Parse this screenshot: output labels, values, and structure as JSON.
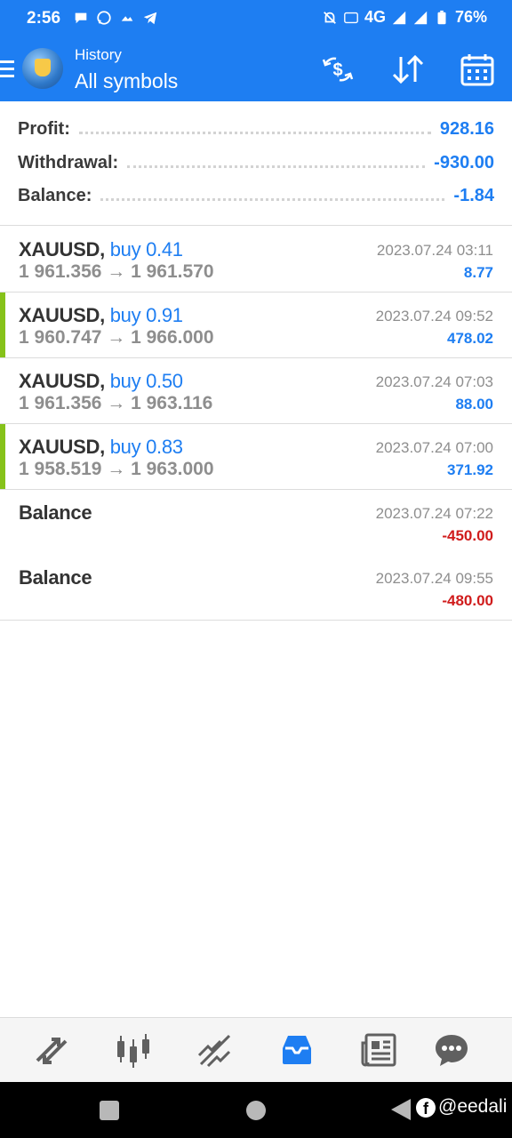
{
  "status": {
    "time": "2:56",
    "network": "4G",
    "battery": "76%"
  },
  "appbar": {
    "subtitle": "History",
    "title": "All symbols",
    "actions": [
      "currency-exchange-icon",
      "sort-icon",
      "calendar-icon"
    ]
  },
  "summary": {
    "profit_label": "Profit:",
    "profit_value": "928.16",
    "withdrawal_label": "Withdrawal:",
    "withdrawal_value": "-930.00",
    "balance_label": "Balance:",
    "balance_value": "-1.84"
  },
  "deals": [
    {
      "symbol": "XAUUSD,",
      "type": "buy 0.41",
      "prices": "1 961.356 → 1 961.570",
      "time": "2023.07.24 03:11",
      "pl": "8.77",
      "highlight": false
    },
    {
      "symbol": "XAUUSD,",
      "type": "buy 0.91",
      "prices": "1 960.747 → 1 966.000",
      "time": "2023.07.24 09:52",
      "pl": "478.02",
      "highlight": true
    },
    {
      "symbol": "XAUUSD,",
      "type": "buy 0.50",
      "prices": "1 961.356 → 1 963.116",
      "time": "2023.07.24 07:03",
      "pl": "88.00",
      "highlight": false
    },
    {
      "symbol": "XAUUSD,",
      "type": "buy 0.83",
      "prices": "1 958.519 → 1 963.000",
      "time": "2023.07.24 07:00",
      "pl": "371.92",
      "highlight": true
    },
    {
      "symbol": "Balance",
      "type": "",
      "prices": "",
      "time": "2023.07.24 07:22",
      "pl": "-450.00",
      "highlight": false
    },
    {
      "symbol": "Balance",
      "type": "",
      "prices": "",
      "time": "2023.07.24 09:55",
      "pl": "-480.00",
      "highlight": false
    }
  ],
  "bottom_nav": [
    "quotes-icon",
    "chart-icon",
    "trade-icon",
    "history-icon",
    "news-icon",
    "chat-icon"
  ],
  "colors": {
    "accent": "#1e7ef2",
    "profit": "#1e7ef2",
    "loss": "#d01c1c",
    "highlight_bar": "#86c21a"
  },
  "watermark": "@eedali"
}
